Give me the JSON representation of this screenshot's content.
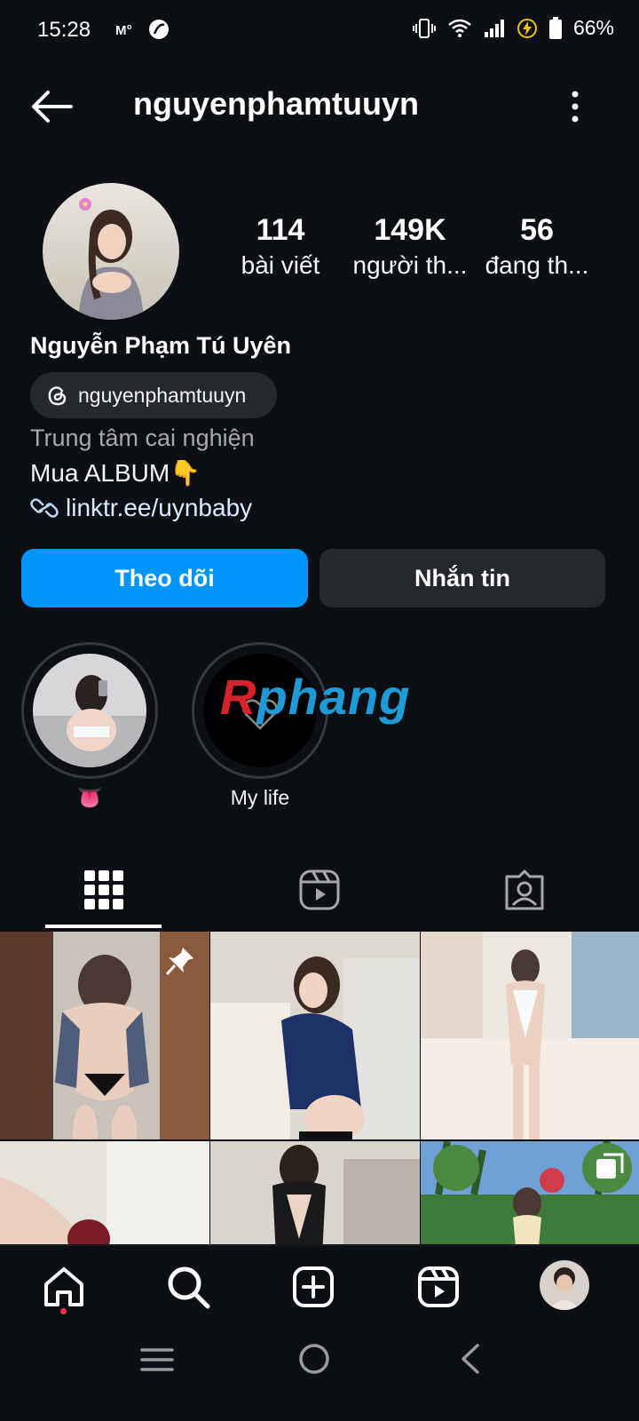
{
  "status_bar": {
    "time": "15:28",
    "left_icons": [
      "mobile-data-icon",
      "app-notification-icon"
    ],
    "right_icons": [
      "vibrate-icon",
      "wifi-icon",
      "signal-icon",
      "battery-saver-icon",
      "battery-icon"
    ],
    "battery_percent": "66%"
  },
  "header": {
    "username": "nguyenphamtuuyn",
    "back_icon": "arrow-left-icon",
    "more_icon": "more-vertical-icon"
  },
  "profile": {
    "posts_count": "114",
    "posts_label": "bài viết",
    "followers_count": "149K",
    "followers_label": "người th...",
    "following_count": "56",
    "following_label": "đang th...",
    "full_name": "Nguyễn Phạm Tú Uyên",
    "threads_handle": "nguyenphamtuuyn",
    "category": "Trung tâm cai nghiện",
    "bio_text": "Mua ALBUM",
    "bio_emoji": "👇",
    "link": "linktr.ee/uynbaby"
  },
  "buttons": {
    "follow": "Theo dõi",
    "message": "Nhắn tin"
  },
  "highlights": [
    {
      "label": "👅"
    },
    {
      "label": "My life"
    }
  ],
  "watermark": {
    "text_prefix": "R",
    "text_rest": "phang",
    "color_prefix": "#d6222a",
    "color_rest": "#1e9bd7"
  },
  "tabs": [
    "grid-icon",
    "reels-icon",
    "tagged-icon"
  ],
  "bottom_nav": [
    "home-icon",
    "search-icon",
    "create-icon",
    "reels-icon",
    "profile-avatar"
  ],
  "system_nav": [
    "recents-icon",
    "home-circle-icon",
    "back-chevron-icon"
  ],
  "colors": {
    "background": "#0c1014",
    "primary_button": "#0095f6",
    "secondary_button": "#25292e",
    "notification_dot": "#ff3040"
  }
}
